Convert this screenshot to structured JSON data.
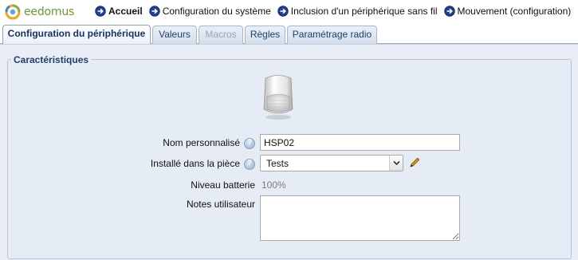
{
  "app": {
    "logo_text": "eedomus"
  },
  "breadcrumbs": [
    {
      "label": "Accueil",
      "bold": true
    },
    {
      "label": "Configuration du système"
    },
    {
      "label": "Inclusion d'un périphérique sans fil"
    },
    {
      "label": "Mouvement (configuration)"
    }
  ],
  "tabs": [
    {
      "label": "Configuration du périphérique",
      "state": "active"
    },
    {
      "label": "Valeurs",
      "state": "normal"
    },
    {
      "label": "Macros",
      "state": "disabled"
    },
    {
      "label": "Règles",
      "state": "normal"
    },
    {
      "label": "Paramétrage radio",
      "state": "normal"
    }
  ],
  "section": {
    "legend": "Caractéristiques",
    "device_icon": "motion-sensor-image",
    "fields": {
      "name": {
        "label": "Nom personnalisé",
        "value": "HSP02"
      },
      "room": {
        "label": "Installé dans la pièce",
        "selected": "Tests"
      },
      "battery": {
        "label": "Niveau batterie",
        "value": "100%"
      },
      "notes": {
        "label": "Notes utilisateur",
        "value": ""
      }
    }
  },
  "colors": {
    "accent": "#1f3f73",
    "panel_bg": "#e9eef6",
    "logo_green": "#6a9a2a"
  }
}
